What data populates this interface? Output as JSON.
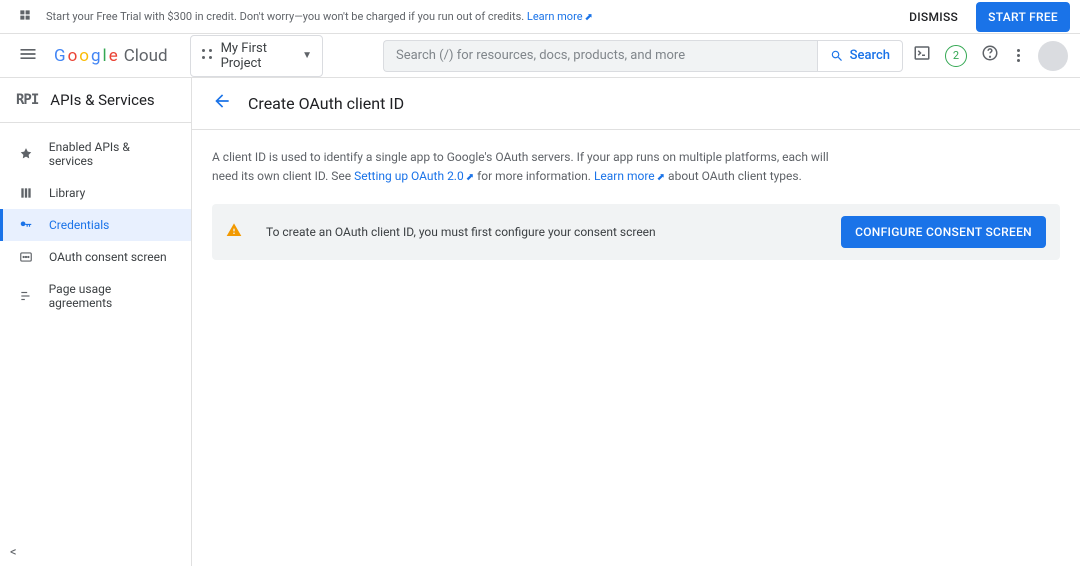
{
  "trial": {
    "text_before_link": "Start your Free Trial with $300 in credit. Don't worry—you won't be charged if you run out of credits. ",
    "learn_more": "Learn more",
    "dismiss": "DISMISS",
    "start_free": "START FREE"
  },
  "header": {
    "cloud_label": "Cloud",
    "project_name": "My First Project",
    "search_placeholder": "Search (/) for resources, docs, products, and more",
    "search_button": "Search",
    "notif_count": "2"
  },
  "sidebar": {
    "section_title": "APIs & Services",
    "items": [
      {
        "label": "Enabled APIs & services"
      },
      {
        "label": "Library"
      },
      {
        "label": "Credentials"
      },
      {
        "label": "OAuth consent screen"
      },
      {
        "label": "Page usage agreements"
      }
    ]
  },
  "content": {
    "title": "Create OAuth client ID",
    "desc_part1": "A client ID is used to identify a single app to Google's OAuth servers. If your app runs on multiple platforms, each will need its own client ID. See ",
    "desc_link1": "Setting up OAuth 2.0",
    "desc_part2": " for more information. ",
    "desc_link2": "Learn more",
    "desc_part3": " about OAuth client types.",
    "alert_text": "To create an OAuth client ID, you must first configure your consent screen",
    "configure_btn": "CONFIGURE CONSENT SCREEN"
  }
}
